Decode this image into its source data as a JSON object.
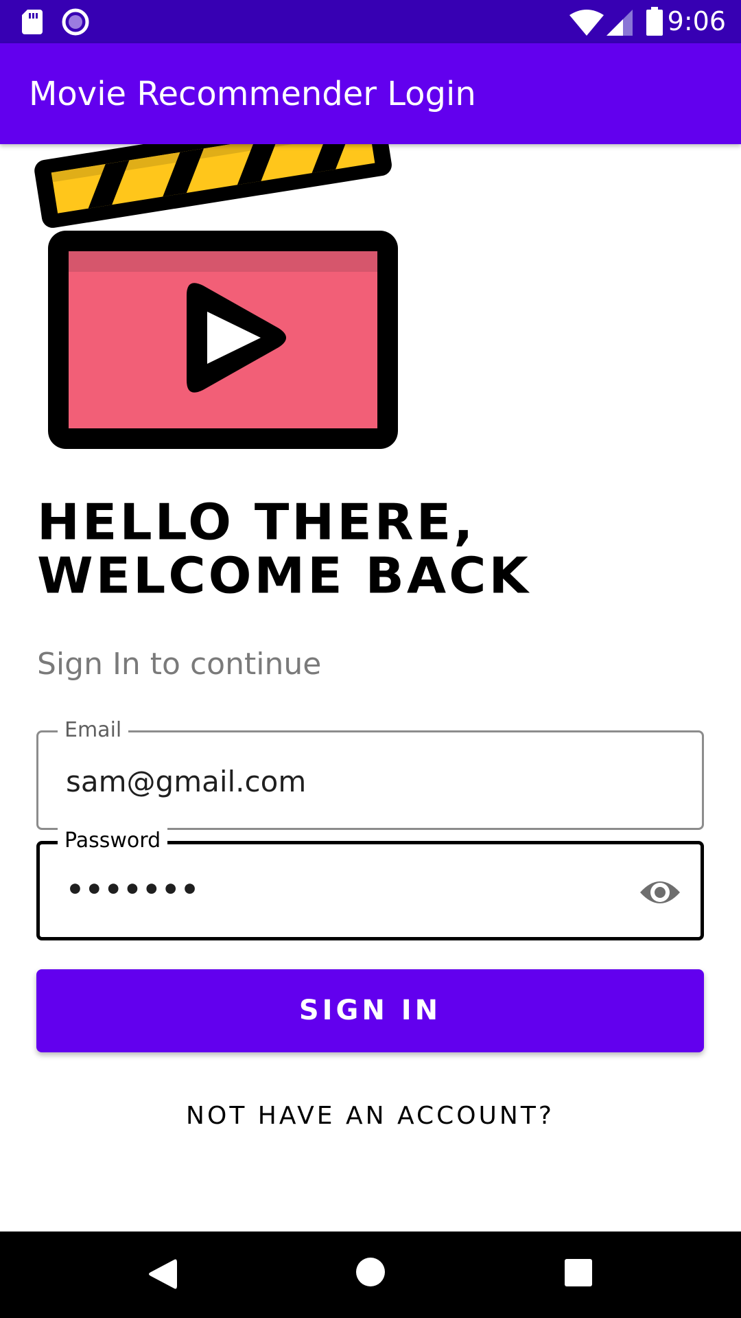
{
  "status_bar": {
    "time": "9:06",
    "icons": [
      "sd-card-icon",
      "circle-notification-icon",
      "wifi-icon",
      "signal-icon",
      "battery-icon"
    ]
  },
  "app_bar": {
    "title": "Movie Recommender Login"
  },
  "logo": {
    "icon": "movie-clapperboard-play-icon",
    "colors": {
      "clapper": "#ffc61b",
      "board": "#f25f77",
      "board_top": "#d6566c",
      "outline": "#000000"
    }
  },
  "headline": {
    "line1": "Hello there,",
    "line2": "welcome back"
  },
  "subtitle": "Sign In to continue",
  "form": {
    "email": {
      "label": "Email",
      "value": "sam@gmail.com"
    },
    "password": {
      "label": "Password",
      "value": "•••••••",
      "toggle_icon": "eye-icon"
    }
  },
  "actions": {
    "sign_in": "Sign In",
    "register": "NOT HAVE AN ACCOUNT?"
  },
  "nav_bar": {
    "buttons": [
      "back-icon",
      "home-icon",
      "recents-icon"
    ]
  },
  "colors": {
    "primary": "#6200ee",
    "primary_dark": "#3700b3"
  }
}
